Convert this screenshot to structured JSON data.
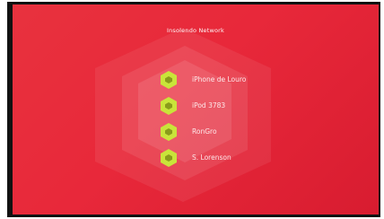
{
  "network": {
    "title": "Insolendo Network"
  },
  "devices": [
    {
      "label": "iPhone de Louro"
    },
    {
      "label": "iPod 3783"
    },
    {
      "label": "RonGro"
    },
    {
      "label": "S. Lorenson"
    }
  ],
  "colors": {
    "background": "#e8283a",
    "icon_outer": "#c9e43a",
    "icon_inner": "#8a9c1a",
    "hexagon_overlay": "#ffffff"
  },
  "icons": {
    "device_icon": "hexagon-device-icon"
  }
}
